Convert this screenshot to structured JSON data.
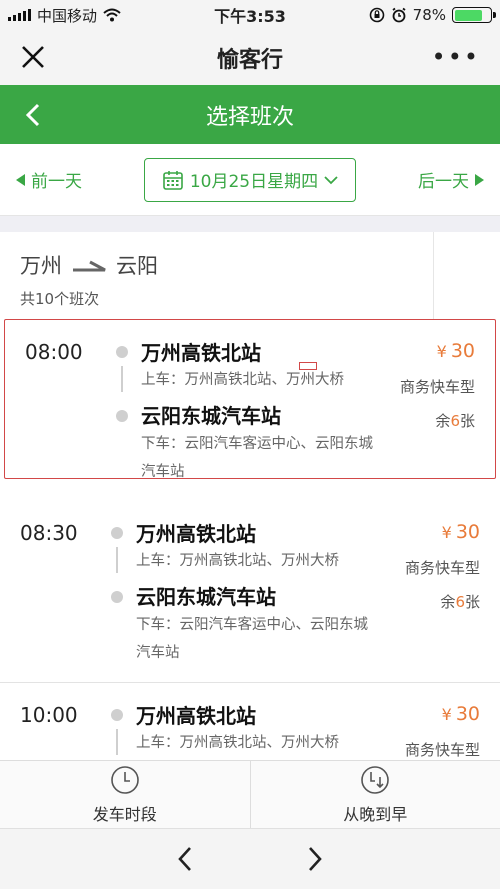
{
  "status_bar": {
    "carrier": "中国移动",
    "time": "下午3:53",
    "battery": "78%",
    "battery_level": 0.78
  },
  "app": {
    "title": "愉客行"
  },
  "header": {
    "title": "选择班次"
  },
  "date_bar": {
    "prev_label": "前一天",
    "date_label": "10月25日星期四",
    "next_label": "后一天"
  },
  "route": {
    "from": "万州",
    "to": "云阳",
    "count_text": "共10个班次"
  },
  "trips": [
    {
      "time": "08:00",
      "depart_station": "万州高铁北站",
      "board_text": "上车：万州高铁北站、万州大桥",
      "arrive_station": "云阳东城汽车站",
      "alight_text": "下车：云阳汽车客运中心、云阳东城汽车站",
      "price_symbol": "¥",
      "price": "30",
      "type": "商务快车型",
      "seats_prefix": "余",
      "seats_count": "6",
      "seats_suffix": "张"
    },
    {
      "time": "08:30",
      "depart_station": "万州高铁北站",
      "board_text": "上车：万州高铁北站、万州大桥",
      "arrive_station": "云阳东城汽车站",
      "alight_text": "下车：云阳汽车客运中心、云阳东城汽车站",
      "price_symbol": "¥",
      "price": "30",
      "type": "商务快车型",
      "seats_prefix": "余",
      "seats_count": "6",
      "seats_suffix": "张"
    },
    {
      "time": "10:00",
      "depart_station": "万州高铁北站",
      "board_text": "上车：万州高铁北站、万州大桥",
      "price_symbol": "¥",
      "price": "30",
      "type": "商务快车型"
    }
  ],
  "bottom_tabs": {
    "depart_period": "发车时段",
    "sort_late_early": "从晚到早"
  },
  "colors": {
    "accent_green": "#3aa745",
    "price_orange": "#e87b3a",
    "highlight_red": "#d24848"
  }
}
